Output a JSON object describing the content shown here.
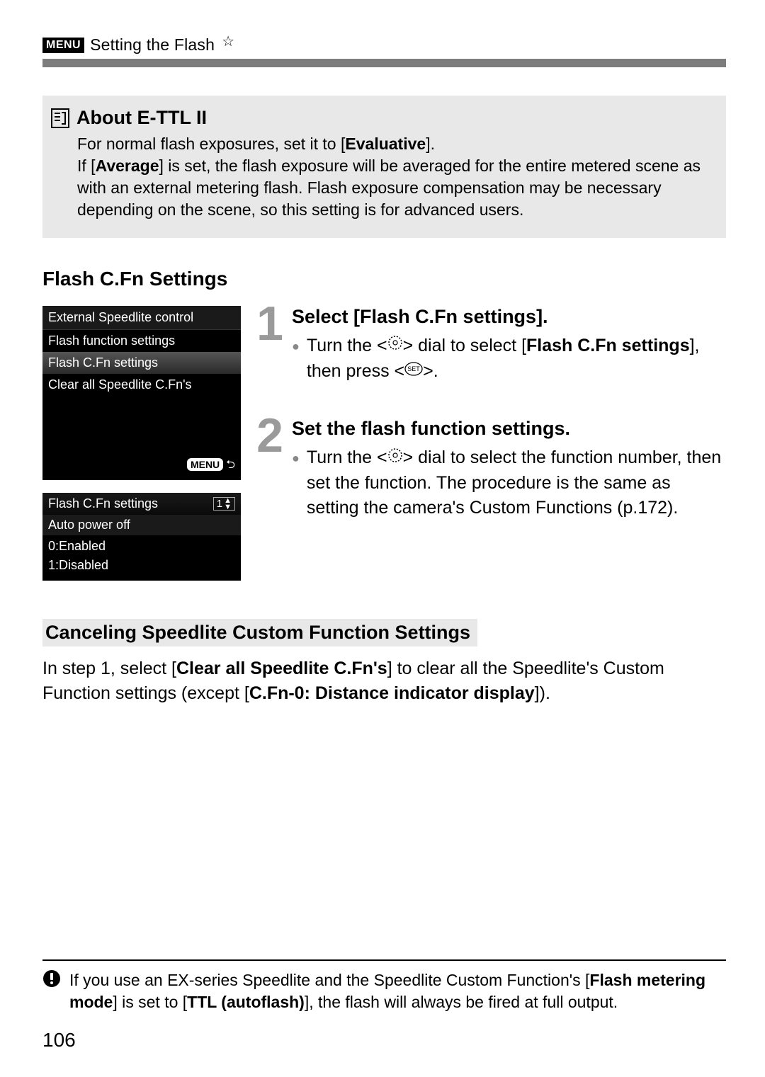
{
  "header": {
    "menu_label": "MENU",
    "title": "Setting the Flash",
    "star": "☆"
  },
  "about_box": {
    "title": "About E-TTL II",
    "line1a": "For normal flash exposures, set it to [",
    "line1b": "Evaluative",
    "line1c": "].",
    "line2a": "If [",
    "line2b": "Average",
    "line2c": "] is set, the flash exposure will be averaged for the entire metered scene as with an external metering flash. Flash exposure compensation may be necessary depending on the scene, so this setting is for advanced users."
  },
  "section1_title": "Flash C.Fn Settings",
  "screen1": {
    "header": "External Speedlite control",
    "item1": "Flash function settings",
    "item2": "Flash C.Fn settings",
    "item3": "Clear all Speedlite C.Fn's",
    "footer_badge": "MENU",
    "footer_symbol": "⮌"
  },
  "screen2": {
    "title": "Flash C.Fn settings",
    "counter_num": "1",
    "sub": "Auto power off",
    "opt0": "0:Enabled",
    "opt1": "1:Disabled"
  },
  "step1": {
    "num": "1",
    "title": "Select [Flash C.Fn settings].",
    "text_a": "Turn the <",
    "text_b": "> dial to select [",
    "text_c": "Flash C.Fn settings",
    "text_d": "], then press <",
    "text_e": ">."
  },
  "step2": {
    "num": "2",
    "title": "Set the flash function settings.",
    "text_a": "Turn the <",
    "text_b": "> dial to select the function number, then set the function. The procedure is the same as setting the camera's Custom Functions (p.172)."
  },
  "cancel": {
    "title": "Canceling Speedlite Custom Function Settings",
    "body_a": "In step 1, select [",
    "body_b": "Clear all Speedlite C.Fn's",
    "body_c": "] to clear all the Speedlite's Custom Function settings (except [",
    "body_d": "C.Fn-0: Distance indicator display",
    "body_e": "])."
  },
  "bottom_note": {
    "a": "If you use an EX-series Speedlite and the Speedlite Custom Function's [",
    "b": "Flash metering mode",
    "c": "] is set to [",
    "d": "TTL (autoflash)",
    "e": "], the flash will always be fired at full output."
  },
  "page_number": "106"
}
